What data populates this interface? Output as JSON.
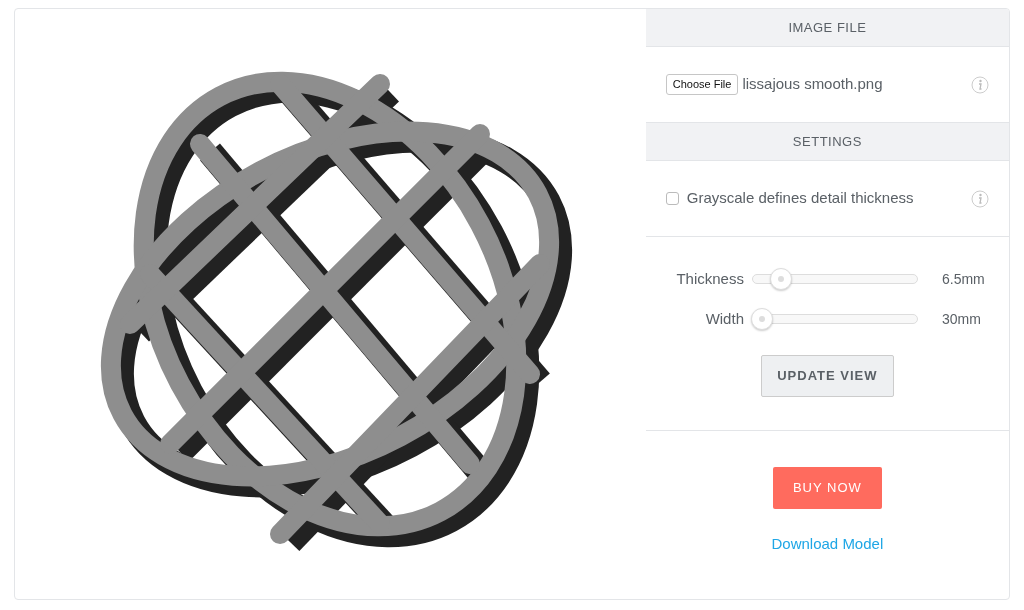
{
  "image_file": {
    "header": "IMAGE FILE",
    "button": "Choose File",
    "file_name": "lissajous smooth.png"
  },
  "settings": {
    "header": "SETTINGS",
    "grayscale": {
      "label": "Grayscale defines detail thickness",
      "checked": false
    },
    "sliders": [
      {
        "label": "Thickness",
        "level": 0.13,
        "reading": "6.5mm"
      },
      {
        "label": "Width",
        "level": 0.0,
        "reading": "30mm"
      }
    ],
    "update_button": "UPDATE VIEW"
  },
  "purchase": {
    "buy_button": "BUY NOW",
    "download_link": "Download Model"
  }
}
